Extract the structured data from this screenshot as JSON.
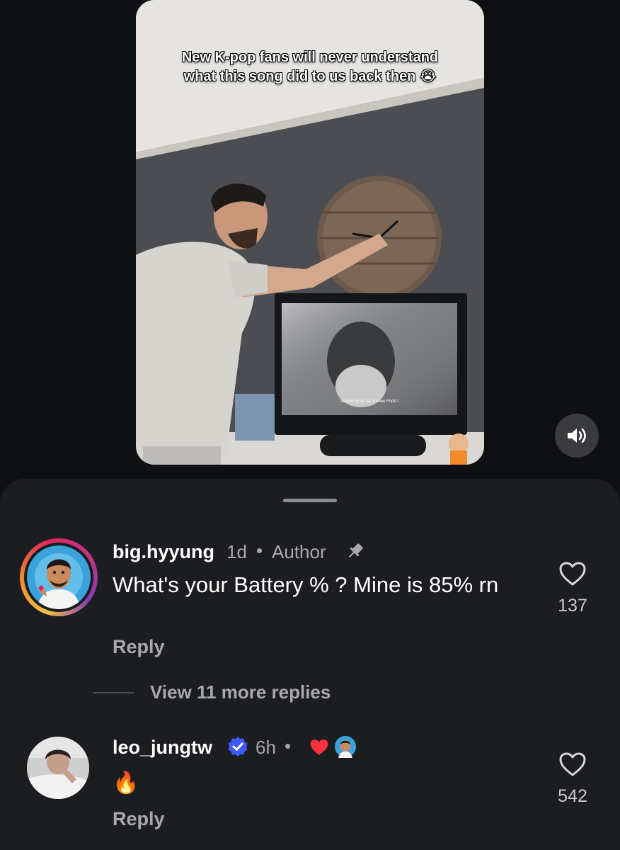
{
  "video": {
    "overlay_text": "New K-pop fans will never understand what this song did to us back then 😭",
    "tv_subtitle": "Vaveyn to op tai ot inew Fnob I"
  },
  "icons": {
    "mute": "volume-icon",
    "like": "heart-outline-icon",
    "pin": "pin-icon",
    "verified": "verified-badge-icon"
  },
  "comments": [
    {
      "username": "big.hyyung",
      "time": "1d",
      "separator": "•",
      "badge": "Author",
      "text": "What's your Battery % ? Mine is 85% rn",
      "reply_label": "Reply",
      "likes": "137"
    },
    {
      "username": "leo_jungtw",
      "time": "6h",
      "separator": "•",
      "text": "🔥",
      "reply_label": "Reply",
      "likes": "542"
    }
  ],
  "view_more_replies": "View 11 more replies",
  "colors": {
    "sheet_bg": "#1c1d21",
    "page_bg": "#0f1014",
    "secondary_text": "#a8a9ae",
    "verified_blue": "#3d5afe",
    "loved_red": "#ff3040"
  }
}
